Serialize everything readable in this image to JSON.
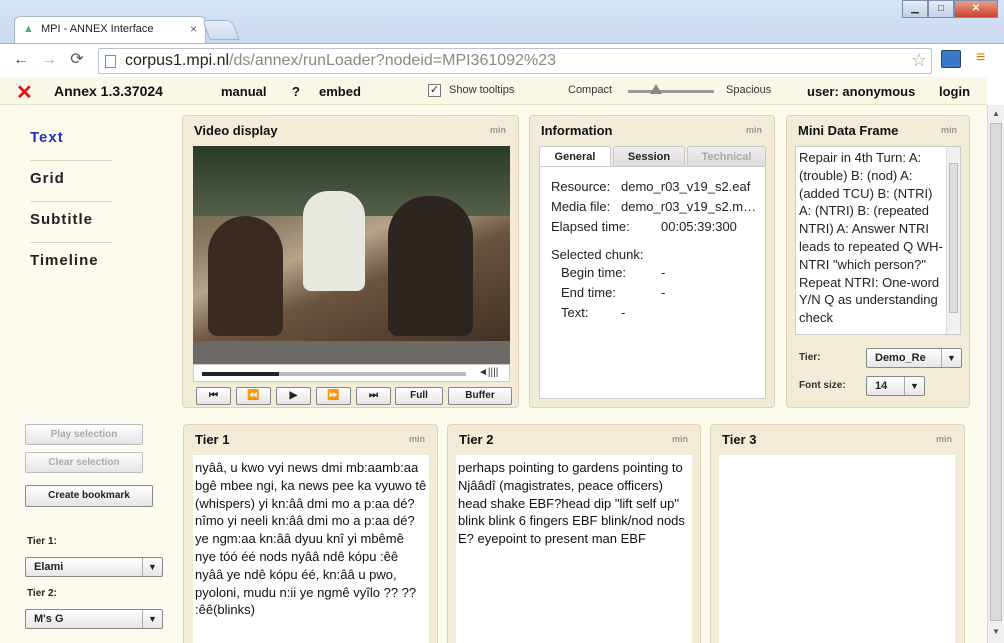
{
  "browser": {
    "tab_title": "MPI - ANNEX Interface",
    "url_host": "corpus1.mpi.nl",
    "url_path": "/ds/annex/runLoader?nodeid=MPI361092%23"
  },
  "header": {
    "app_title": "Annex 1.3.37024",
    "manual": "manual",
    "help": "?",
    "embed": "embed",
    "show_tooltips": "Show tooltips",
    "compact": "Compact",
    "spacious": "Spacious",
    "user": "user: anonymous",
    "login": "login"
  },
  "nav": {
    "items": [
      "Text",
      "Grid",
      "Subtitle",
      "Timeline"
    ]
  },
  "video": {
    "title": "Video display",
    "min": "min",
    "progress": 0.29,
    "controls": {
      "full": "Full",
      "buffer": "Buffer"
    }
  },
  "info": {
    "title": "Information",
    "min": "min",
    "tabs": [
      "General",
      "Session",
      "Technical"
    ],
    "resource_label": "Resource:",
    "resource": "demo_r03_v19_s2.eaf",
    "media_label": "Media file:",
    "media": "demo_r03_v19_s2.m…",
    "elapsed_label": "Elapsed time:",
    "elapsed": "00:05:39:300",
    "chunk_label": "Selected chunk:",
    "begin_label": "Begin time:",
    "begin": "-",
    "end_label": "End time:",
    "end": "-",
    "text_label": "Text:",
    "text": "-"
  },
  "mdf": {
    "title": "Mini Data Frame",
    "min": "min",
    "text": "Repair in 4th Turn: A: (trouble) B: (nod) A: (added TCU) B: (NTRI) A: (NTRI) B: (repeated NTRI) A: Answer NTRI leads to repeated Q WH-NTRI \"which person?\" Repeat NTRI: One-word Y/N Q as understanding check",
    "tier_label": "Tier:",
    "tier_value": "Demo_Re",
    "font_label": "Font size:",
    "font_value": "14"
  },
  "left": {
    "play": "Play selection",
    "clear": "Clear selection",
    "bookmark": "Create bookmark",
    "tier1_label": "Tier 1:",
    "tier1_value": "Elami",
    "tier2_label": "Tier 2:",
    "tier2_value": "M's G"
  },
  "tiers": [
    {
      "title": "Tier 1",
      "min": "min",
      "text": " nyââ, u kwo vyi news dmi mb:aamb:aa bgê mbee ngi, ka news pee ka vyuwo tê (whispers) yi kn:ââ dmi mo a p:aa dé? nîmo yi neeli kn:ââ dmi mo a p:aa dé? ye ngm:aa kn:ââ dyuu knî yi mbêmê nye tóó éé nods nyââ ndê kópu :êê nyââ ye ndê kópu éé, kn:ââ u pwo, pyoloni, mudu n:ii ye ngmê vyîlo ?? ?? :êê(blinks)"
    },
    {
      "title": "Tier 2",
      "min": "min",
      "text": "perhaps pointing to gardens pointing to Njââdî (magistrates, peace officers) head shake EBF?head dip \"lift self up\" blink blink 6 fingers EBF blink/nod nods E? eyepoint to present man EBF"
    },
    {
      "title": "Tier 3",
      "min": "min",
      "text": ""
    }
  ]
}
